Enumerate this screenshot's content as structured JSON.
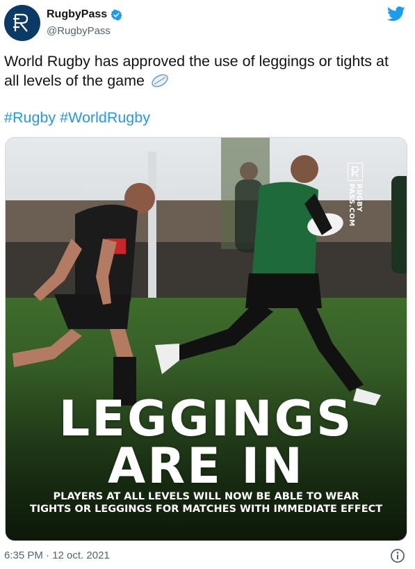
{
  "author": {
    "display_name": "RugbyPass",
    "handle": "@RugbyPass",
    "verified": true
  },
  "tweet": {
    "text": "World Rugby has approved the use of leggings or tights at all levels of the game",
    "emoji": "rugby-ball-icon",
    "hashtags": [
      "#Rugby",
      "#WorldRugby"
    ]
  },
  "media": {
    "watermark": "RUGBY\nPASS.COM",
    "headline_line1": "LEGGINGS",
    "headline_line2": "ARE IN",
    "subline1": "PLAYERS AT ALL LEVELS WILL NOW BE ABLE TO WEAR",
    "subline2": "TIGHTS OR LEGGINGS FOR MATCHES WITH IMMEDIATE EFFECT"
  },
  "meta": {
    "timestamp": "6:35 PM · 12 oct. 2021"
  },
  "colors": {
    "brand_blue": "#1d9bf0",
    "text": "#0f1419",
    "muted": "#536471",
    "avatar_bg": "#0b3a66"
  },
  "icons": [
    "twitter-bird-icon",
    "verified-badge-icon",
    "info-icon",
    "rugby-ball-icon",
    "rugbypass-logo"
  ]
}
